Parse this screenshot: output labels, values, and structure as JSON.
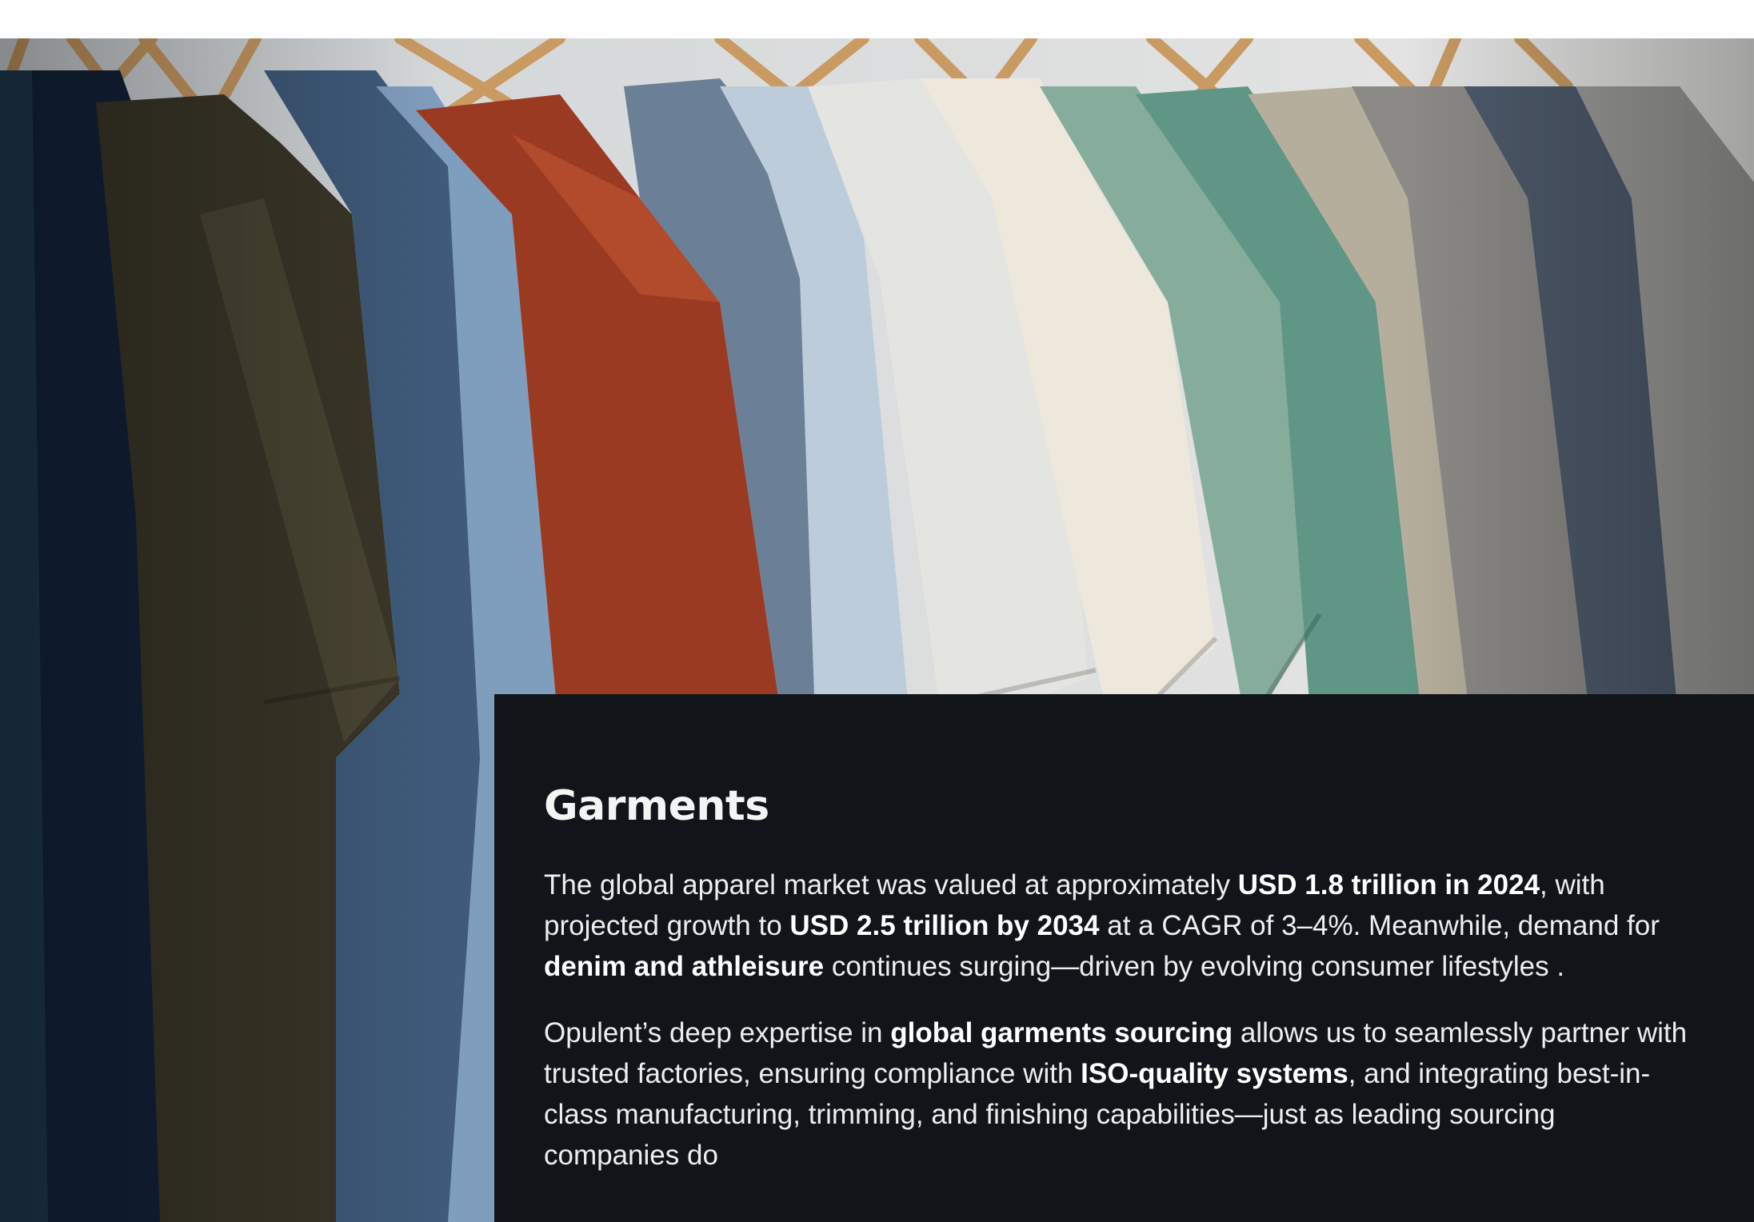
{
  "section": {
    "title": "Garments",
    "paragraph_1": {
      "t1": "The global apparel market was valued at approximately ",
      "b1": "USD 1.8 trillion in 2024",
      "t2": ", with projected growth to ",
      "b2": "USD 2.5 trillion by 2034",
      "t3": " at a CAGR of 3–4%. Meanwhile, demand for ",
      "b3": "denim and athleisure",
      "t4": " continues surging—driven by evolving consumer lifestyles ."
    },
    "paragraph_2": {
      "t1": "Opulent’s deep expertise in ",
      "b1": "global garments sourcing",
      "t2": " allows us to seamlessly partner with trusted factories, ensuring compliance with ",
      "b2": "ISO-quality systems",
      "t3": ", and integrating best-in-class manufacturing, trimming, and finishing capabilities—just as leading sourcing companies do"
    }
  },
  "colors": {
    "card_background": "#111519",
    "page_background": "#ffffff"
  }
}
